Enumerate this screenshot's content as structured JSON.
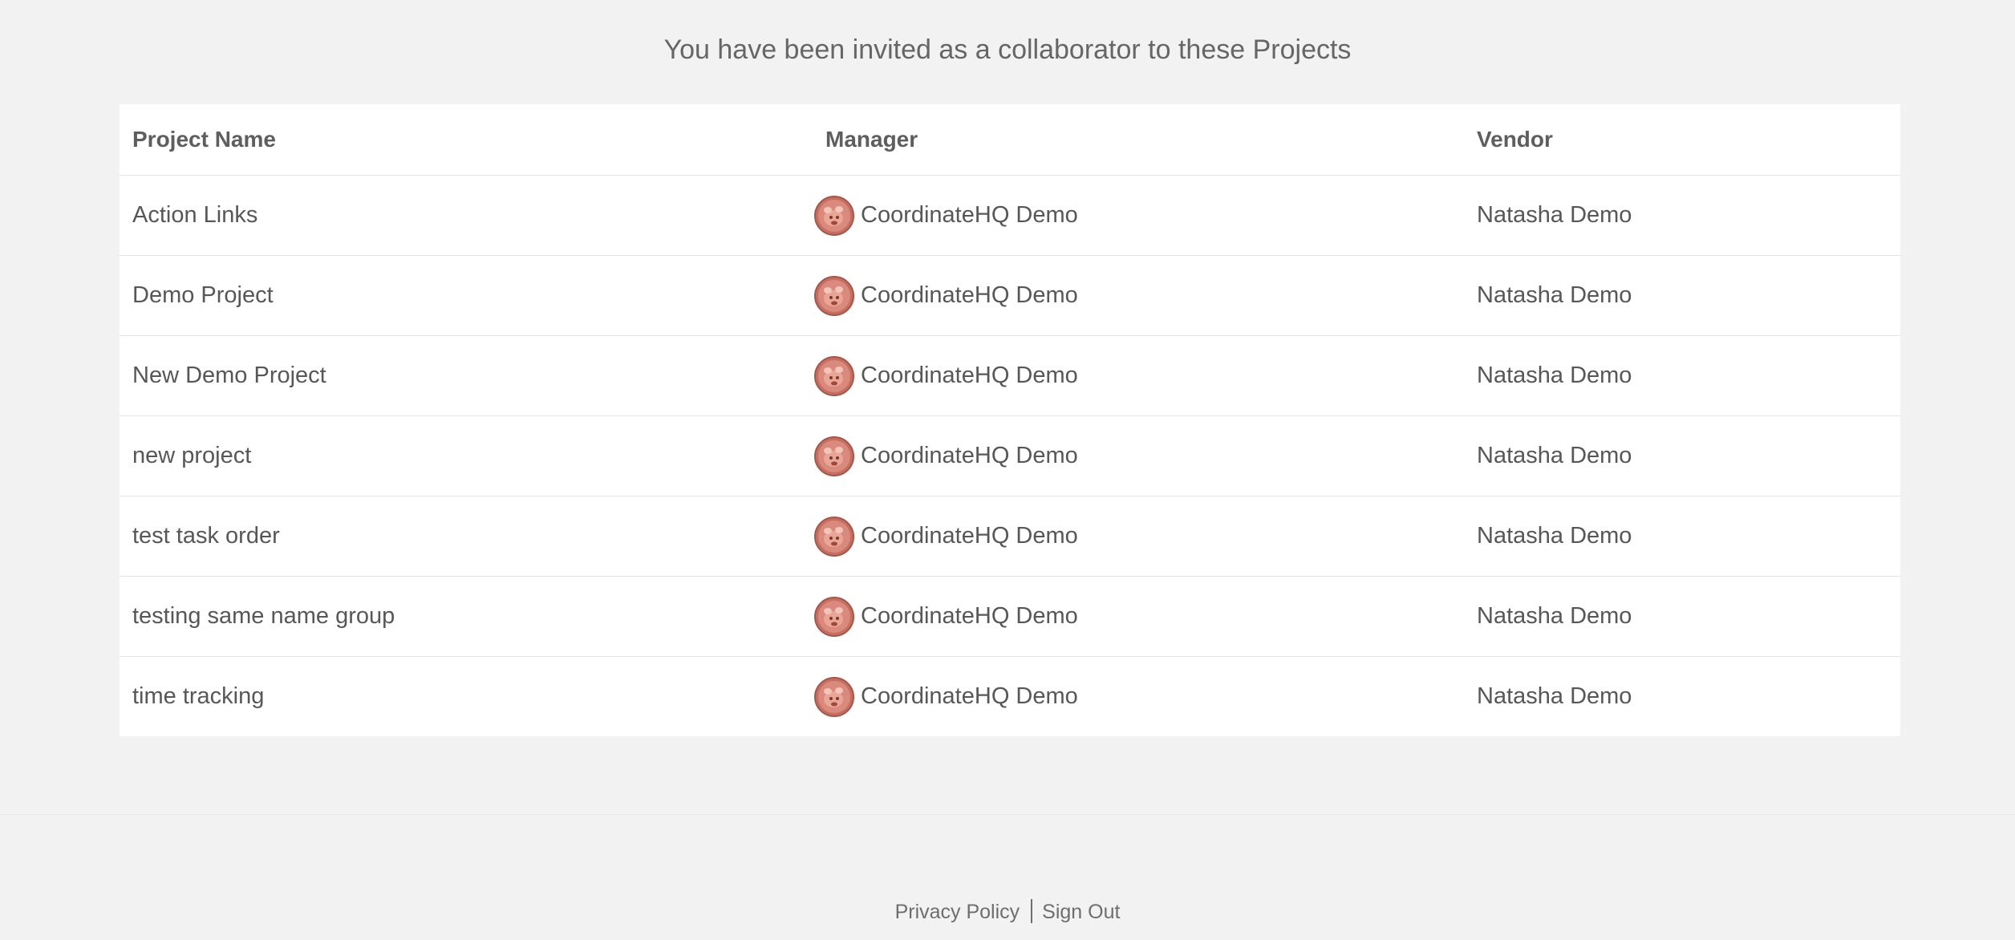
{
  "heading": "You have been invited as a collaborator to these Projects",
  "table": {
    "headers": {
      "project": "Project Name",
      "manager": "Manager",
      "vendor": "Vendor"
    },
    "rows": [
      {
        "project": "Action Links",
        "manager": "CoordinateHQ Demo",
        "vendor": "Natasha Demo"
      },
      {
        "project": "Demo Project",
        "manager": "CoordinateHQ Demo",
        "vendor": "Natasha Demo"
      },
      {
        "project": "New Demo Project",
        "manager": "CoordinateHQ Demo",
        "vendor": "Natasha Demo"
      },
      {
        "project": "new project",
        "manager": "CoordinateHQ Demo",
        "vendor": "Natasha Demo"
      },
      {
        "project": "test task order",
        "manager": "CoordinateHQ Demo",
        "vendor": "Natasha Demo"
      },
      {
        "project": "testing same name group",
        "manager": "CoordinateHQ Demo",
        "vendor": "Natasha Demo"
      },
      {
        "project": "time tracking",
        "manager": "CoordinateHQ Demo",
        "vendor": "Natasha Demo"
      }
    ]
  },
  "footer": {
    "privacy": "Privacy Policy",
    "signout": "Sign Out"
  },
  "icons": {
    "avatar": "user-avatar-icon"
  },
  "colors": {
    "background": "#f2f2f2",
    "card": "#ffffff",
    "avatar": "#c9776a"
  }
}
